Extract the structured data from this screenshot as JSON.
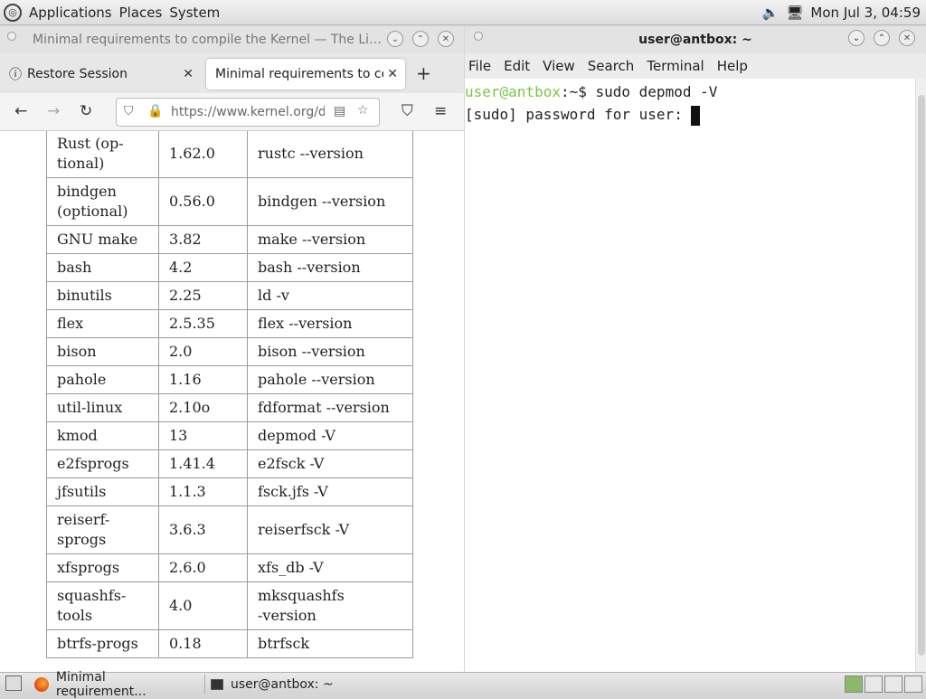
{
  "top_panel": {
    "menus": [
      "Applications",
      "Places",
      "System"
    ],
    "clock": "Mon Jul 3, 04:59"
  },
  "firefox": {
    "window_title": "Minimal requirements to compile the Kernel — The Lin…",
    "tabs": [
      {
        "label": "Restore Session"
      },
      {
        "label": "Minimal requirements to compile the Kernel"
      }
    ],
    "url": "https://www.kernel.org/doc/html/latest/process/changes.html",
    "table_rows": [
      [
        "Rust (op-\ntional)",
        "1.62.0",
        "rustc --version"
      ],
      [
        "bindgen\n(optional)",
        "0.56.0",
        "bindgen --version"
      ],
      [
        "GNU make",
        "3.82",
        "make --version"
      ],
      [
        "bash",
        "4.2",
        "bash --version"
      ],
      [
        "binutils",
        "2.25",
        "ld -v"
      ],
      [
        "flex",
        "2.5.35",
        "flex --version"
      ],
      [
        "bison",
        "2.0",
        "bison --version"
      ],
      [
        "pahole",
        "1.16",
        "pahole --version"
      ],
      [
        "util-linux",
        "2.10o",
        "fdformat --version"
      ],
      [
        "kmod",
        "13",
        "depmod -V"
      ],
      [
        "e2fsprogs",
        "1.41.4",
        "e2fsck -V"
      ],
      [
        "jfsutils",
        "1.1.3",
        "fsck.jfs -V"
      ],
      [
        "reiserf-\nsprogs",
        "3.6.3",
        "reiserfsck -V"
      ],
      [
        "xfsprogs",
        "2.6.0",
        "xfs_db -V"
      ],
      [
        "squashfs-\ntools",
        "4.0",
        "mksquashfs\n-version"
      ],
      [
        "btrfs-progs",
        "0.18",
        "btrfsck"
      ]
    ]
  },
  "terminal": {
    "window_title": "user@antbox: ~",
    "menu": [
      "File",
      "Edit",
      "View",
      "Search",
      "Terminal",
      "Help"
    ],
    "prompt_user": "user@antbox",
    "prompt_path": ":~$ ",
    "command": "sudo depmod -V",
    "line2": "[sudo] password for user: "
  },
  "taskbar": {
    "items": [
      "Minimal requirement...",
      "user@antbox: ~"
    ]
  },
  "colors": {
    "prompt_green": "#7ac54a",
    "workspace_active": "#8cb86a"
  }
}
